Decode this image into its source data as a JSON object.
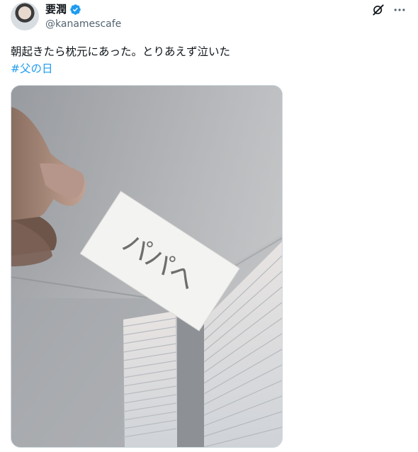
{
  "user": {
    "display_name": "要潤",
    "handle": "@kanamescafe"
  },
  "tweet": {
    "text": "朝起きたら枕元にあった。とりあえず泣いた",
    "hashtag": "#父の日"
  },
  "media": {
    "note_text": "パパへ"
  },
  "icons": {
    "verified": "verified-badge-icon",
    "grok": "grok-icon",
    "more": "more-icon"
  },
  "colors": {
    "accent": "#1d9bf0",
    "secondary_text": "#536471"
  }
}
